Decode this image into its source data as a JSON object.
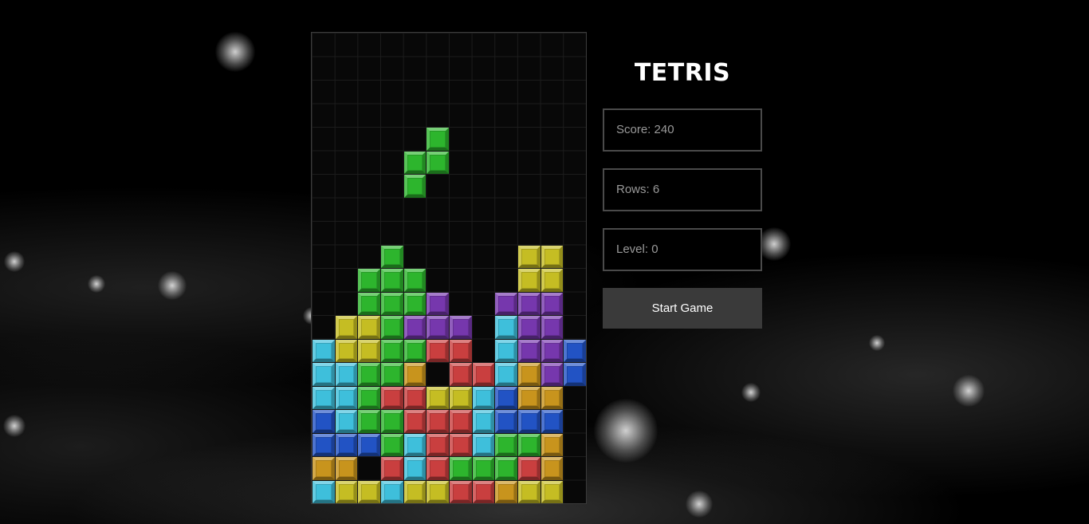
{
  "title": "TETRIS",
  "stats": {
    "score_label": "Score: 240",
    "rows_label": "Rows: 6",
    "level_label": "Level: 0"
  },
  "start_button_label": "Start Game",
  "board": {
    "cols": 12,
    "rows": 20,
    "colors": {
      "G": "#2db52d",
      "Y": "#c5bd23",
      "P": "#7637ad",
      "C": "#3ebfdb",
      "R": "#c93f3f",
      "O": "#c8941d",
      "B": "#2253c4"
    },
    "active_piece": {
      "shape": "S",
      "color": "G",
      "cells": [
        [
          4,
          5
        ],
        [
          5,
          4
        ],
        [
          5,
          5
        ],
        [
          6,
          4
        ]
      ]
    },
    "grid": [
      "............",
      "............",
      "............",
      "............",
      "............",
      "............",
      "............",
      "............",
      "............",
      "...G.....YY.",
      "..GGG....YY.",
      "..GGGP..PPP.",
      ".YYGPPP.CPP.",
      "CYYGGRR.CPPB",
      "CCGGO.RRCOPB",
      "CCGRRYYCBOO.",
      "BCGGRRRCBBB.",
      "BBBGCRRCGGO.",
      "OO.RCRGGGRO.",
      "CYYCYYRROYY."
    ]
  }
}
